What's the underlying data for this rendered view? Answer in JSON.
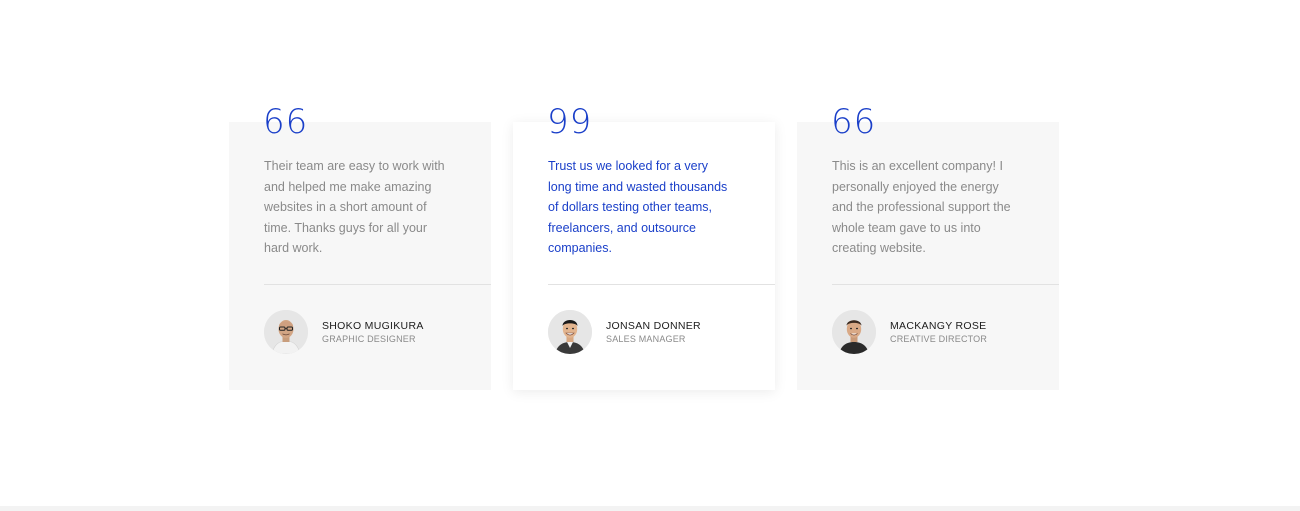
{
  "theme": {
    "accent": "#1a3fc9",
    "body_text": "#8a8a8a",
    "card_bg": "#f7f7f7",
    "featured_bg": "#ffffff"
  },
  "testimonials": [
    {
      "quote_mark": "66",
      "text": "Their team are easy to work with and helped me make amazing websites in a short amount of time. Thanks guys for all your hard work.",
      "name": "SHOKO MUGIKURA",
      "role": "GRAPHIC DESIGNER",
      "avatar_icon": "avatar-bald-glasses-icon",
      "featured": false
    },
    {
      "quote_mark": "99",
      "text": "Trust us we looked for a very long time and wasted thousands of dollars testing other teams, freelancers, and outsource companies.",
      "name": "JONSAN DONNER",
      "role": "SALES MANAGER",
      "avatar_icon": "avatar-smiling-man-icon",
      "featured": true
    },
    {
      "quote_mark": "66",
      "text": "This is an excellent company! I personally enjoyed the energy and the professional support the whole team gave to us into creating website.",
      "name": "MACKANGY ROSE",
      "role": "CREATIVE DIRECTOR",
      "avatar_icon": "avatar-man-icon",
      "featured": false
    }
  ]
}
